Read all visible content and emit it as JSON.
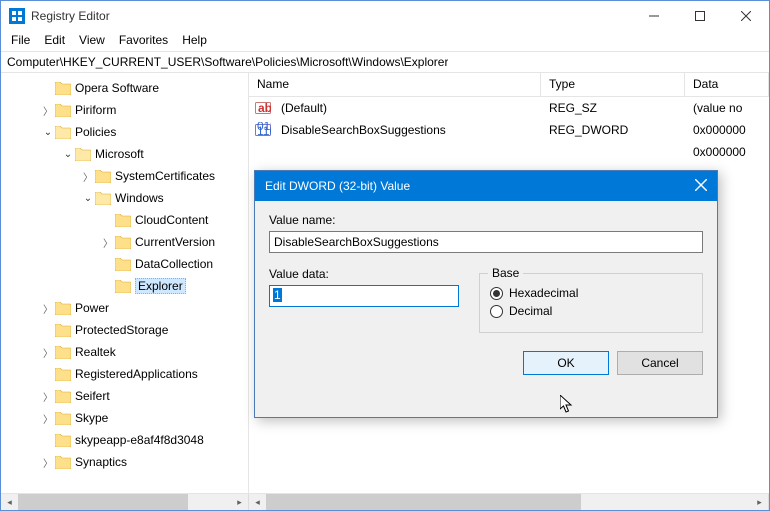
{
  "window": {
    "title": "Registry Editor"
  },
  "menu": {
    "file": "File",
    "edit": "Edit",
    "view": "View",
    "favorites": "Favorites",
    "help": "Help"
  },
  "path": "Computer\\HKEY_CURRENT_USER\\Software\\Policies\\Microsoft\\Windows\\Explorer",
  "tree": [
    {
      "label": "Opera Software",
      "indent": 2,
      "expand": "none"
    },
    {
      "label": "Piriform",
      "indent": 2,
      "expand": "collapsed"
    },
    {
      "label": "Policies",
      "indent": 2,
      "expand": "expanded"
    },
    {
      "label": "Microsoft",
      "indent": 3,
      "expand": "expanded"
    },
    {
      "label": "SystemCertificates",
      "indent": 4,
      "expand": "collapsed"
    },
    {
      "label": "Windows",
      "indent": 4,
      "expand": "expanded"
    },
    {
      "label": "CloudContent",
      "indent": 5,
      "expand": "none"
    },
    {
      "label": "CurrentVersion",
      "indent": 5,
      "expand": "collapsed"
    },
    {
      "label": "DataCollection",
      "indent": 5,
      "expand": "none"
    },
    {
      "label": "Explorer",
      "indent": 5,
      "expand": "none",
      "selected": true
    },
    {
      "label": "Power",
      "indent": 2,
      "expand": "collapsed"
    },
    {
      "label": "ProtectedStorage",
      "indent": 2,
      "expand": "none"
    },
    {
      "label": "Realtek",
      "indent": 2,
      "expand": "collapsed"
    },
    {
      "label": "RegisteredApplications",
      "indent": 2,
      "expand": "none"
    },
    {
      "label": "Seifert",
      "indent": 2,
      "expand": "collapsed"
    },
    {
      "label": "Skype",
      "indent": 2,
      "expand": "collapsed"
    },
    {
      "label": "skypeapp-e8af4f8d3048",
      "indent": 2,
      "expand": "none"
    },
    {
      "label": "Synaptics",
      "indent": 2,
      "expand": "collapsed"
    }
  ],
  "columns": {
    "name": "Name",
    "type": "Type",
    "data": "Data"
  },
  "rows": [
    {
      "icon": "string",
      "name": "(Default)",
      "type": "REG_SZ",
      "data": "(value no"
    },
    {
      "icon": "binary",
      "name": "DisableSearchBoxSuggestions",
      "type": "REG_DWORD",
      "data": "0x000000"
    },
    {
      "icon": "",
      "name": "",
      "type": "",
      "data": "0x000000"
    }
  ],
  "dialog": {
    "title": "Edit DWORD (32-bit) Value",
    "value_name_label": "Value name:",
    "value_name": "DisableSearchBoxSuggestions",
    "value_data_label": "Value data:",
    "value_data": "1",
    "base_label": "Base",
    "hex_label": "Hexadecimal",
    "dec_label": "Decimal",
    "base_selected": "hex",
    "ok": "OK",
    "cancel": "Cancel"
  }
}
